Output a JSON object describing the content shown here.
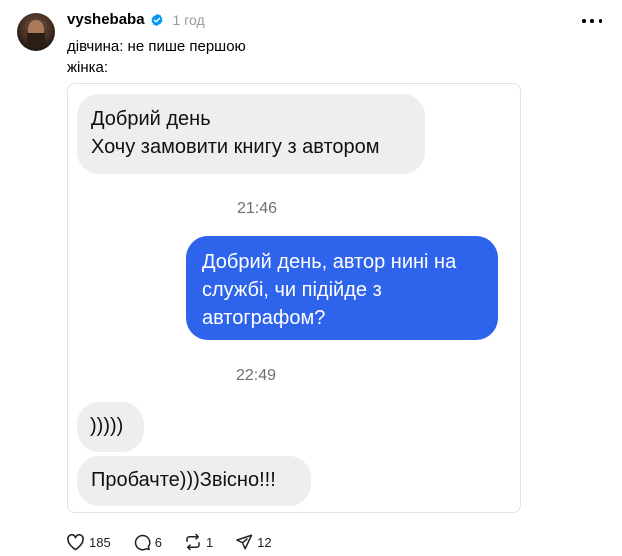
{
  "post": {
    "username": "vyshebaba",
    "time": "1 год",
    "caption_lines": [
      "дівчина: не пише першою",
      "жінка:"
    ]
  },
  "chat": {
    "msg1_lines": [
      "Добрий день",
      "Хочу замовити книгу з автором"
    ],
    "time1": "21:46",
    "msg2_lines": [
      "Добрий день, автор нині на",
      "службі, чи підійде з",
      "автографом?"
    ],
    "time2": "22:49",
    "msg3": ")))))",
    "msg4": "Пробачте)))Звісно!!!"
  },
  "actions": {
    "likes": "185",
    "comments": "6",
    "reposts": "1",
    "shares": "12"
  },
  "colors": {
    "verified": "#0095f6",
    "outgoing_bubble": "#2e64ec",
    "incoming_bubble": "#eeeef0"
  }
}
